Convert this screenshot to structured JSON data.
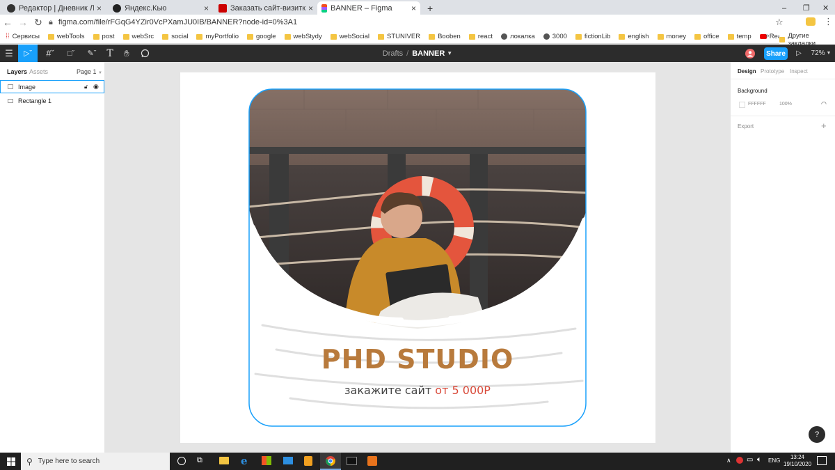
{
  "tabs": [
    {
      "title": "Редактор | Дневник Лоха | Янде",
      "close": "×",
      "color": "#333333"
    },
    {
      "title": "Яндекс.Кью",
      "close": "×",
      "color": "#222222"
    },
    {
      "title": "Заказать сайт-визитку, лэндинг",
      "close": "×",
      "color": "#cc0000"
    },
    {
      "title": "BANNER – Figma",
      "close": "×",
      "color": "#f24e1e",
      "active": true
    }
  ],
  "new_tab": "+",
  "window": {
    "minimize": "–",
    "restore": "❐",
    "close": "✕"
  },
  "url": "figma.com/file/rFGqG4YZir0VcPXamJU0IB/BANNER?node-id=0%3A1",
  "bookmarks": [
    "Сервисы",
    "webTools",
    "post",
    "webSrc",
    "social",
    "myPortfolio",
    "google",
    "webStydy",
    "webSocial",
    "STUNIVER",
    "Booben",
    "react",
    "локалка",
    "3000",
    "fictionLib",
    "english",
    "money",
    "office",
    "temp",
    "React путь самурая"
  ],
  "bookmarks_more": "»",
  "bookmarks_other": "Другие закладки",
  "breadcrumb": {
    "drafts": "Drafts",
    "sep": "/",
    "file": "BANNER"
  },
  "toolbar": {
    "share": "Share",
    "zoom": "72%"
  },
  "left_panel": {
    "tabs": [
      "Layers",
      "Assets"
    ],
    "page": "Page 1",
    "layers": [
      "Image",
      "Rectangle 1"
    ]
  },
  "right_panel": {
    "tabs": [
      "Design",
      "Prototype",
      "Inspect"
    ],
    "background_label": "Background",
    "bg_hex": "FFFFFF",
    "bg_opacity": "100%",
    "export_label": "Export",
    "export_add": "+"
  },
  "banner": {
    "title": "PHD STUDIO",
    "subtitle_main": "закажите сайт",
    "subtitle_price": "от 5 000Р",
    "title_color": "#b87a3c",
    "price_color": "#d94a3a"
  },
  "help": "?",
  "taskbar": {
    "search_placeholder": "Type here to search",
    "lang": "ENG",
    "time": "13:24",
    "date": "19/10/2020"
  },
  "colors": {
    "figma_blue": "#18a0fb",
    "toolbar_bg": "#2c2c2c"
  }
}
